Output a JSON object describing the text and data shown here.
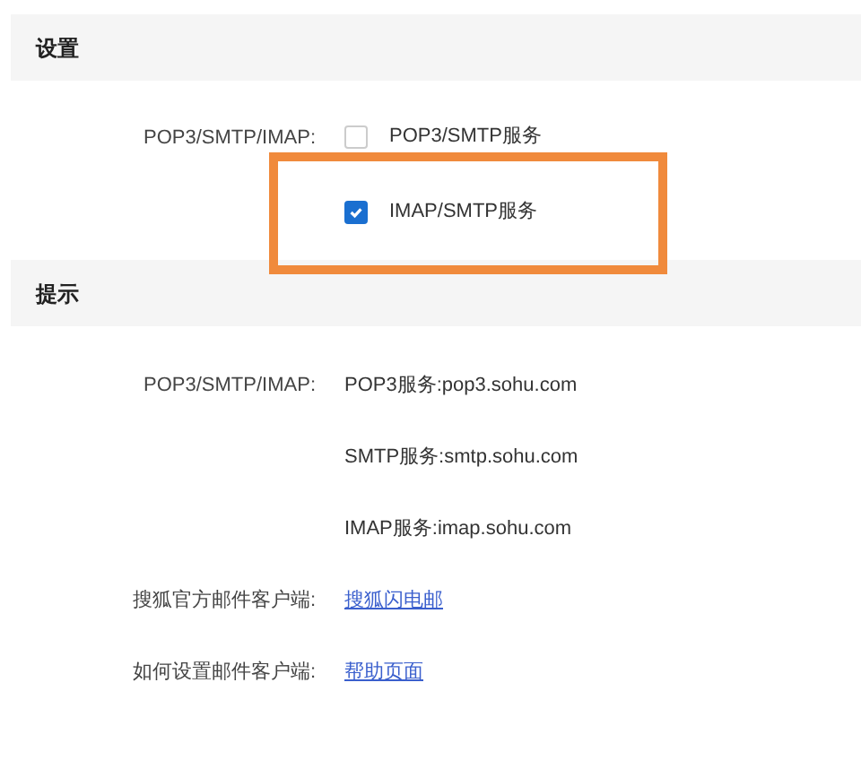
{
  "settings": {
    "title": "设置",
    "label": "POP3/SMTP/IMAP:",
    "options": [
      {
        "label": "POP3/SMTP服务",
        "checked": false
      },
      {
        "label": "IMAP/SMTP服务",
        "checked": true
      }
    ],
    "highlight": true
  },
  "tips": {
    "title": "提示",
    "rows": [
      {
        "label": "POP3/SMTP/IMAP:",
        "kind": "text",
        "values": [
          "POP3服务:pop3.sohu.com",
          "SMTP服务:smtp.sohu.com",
          "IMAP服务:imap.sohu.com"
        ]
      },
      {
        "label": "搜狐官方邮件客户端:",
        "kind": "link",
        "values": [
          "搜狐闪电邮"
        ]
      },
      {
        "label": "如何设置邮件客户端:",
        "kind": "link",
        "values": [
          "帮助页面"
        ]
      }
    ]
  }
}
